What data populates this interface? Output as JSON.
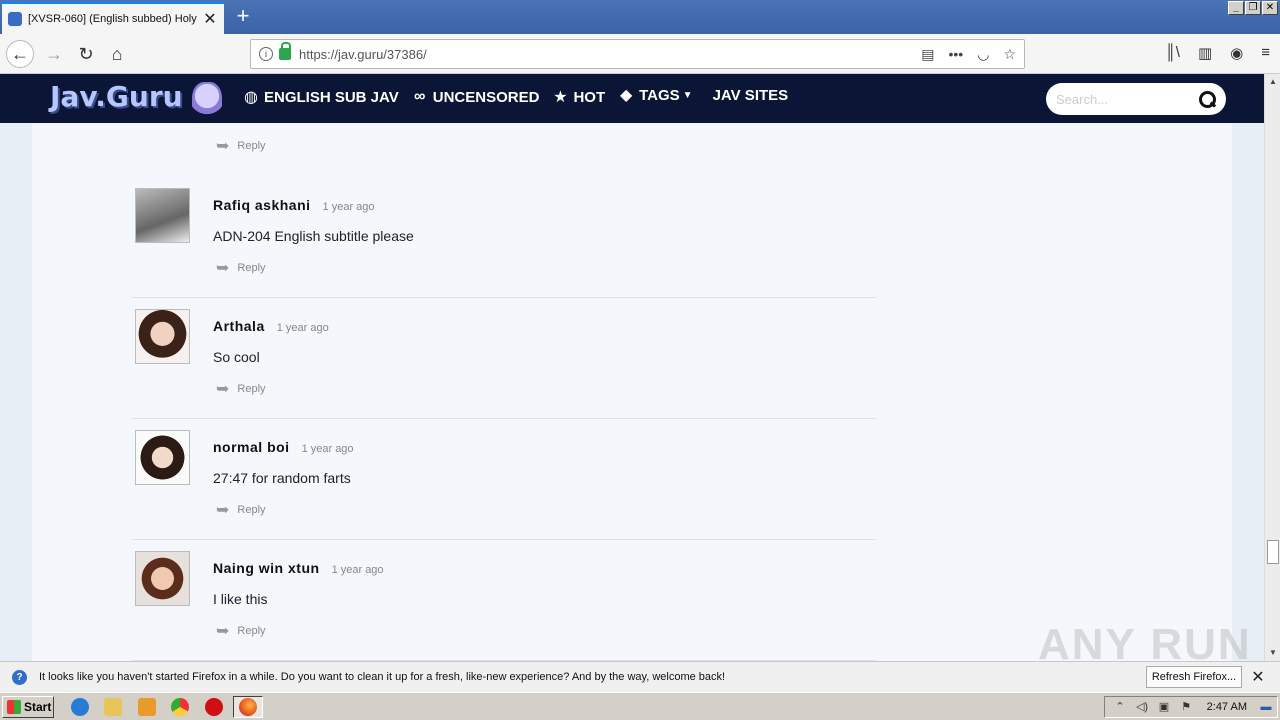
{
  "browser": {
    "tab_title": "[XVSR-060] (English subbed) Holy",
    "url": "https://jav.guru/37386/",
    "new_tab_symbol": "+"
  },
  "site": {
    "logo": "Jav.Guru",
    "menu": [
      {
        "label": "ENGLISH SUB JAV",
        "icon": "globe-icon"
      },
      {
        "label": "UNCENSORED",
        "icon": "glasses-icon"
      },
      {
        "label": "HOT",
        "icon": "star-icon"
      },
      {
        "label": "TAGS",
        "icon": "tag-icon"
      },
      {
        "label": "JAV SITES",
        "icon": ""
      }
    ],
    "search_placeholder": "Search..."
  },
  "reply_label": "Reply",
  "comments": [
    {
      "author": "Rafiq askhani",
      "time": "1 year ago",
      "text": "ADN-204 English subtitle please"
    },
    {
      "author": "Arthala",
      "time": "1 year ago",
      "text": "So cool"
    },
    {
      "author": "normal boi",
      "time": "1 year ago",
      "text": "27:47 for random farts"
    },
    {
      "author": "Naing win xtun",
      "time": "1 year ago",
      "text": "I like this"
    }
  ],
  "notification": {
    "text": "It looks like you haven't started Firefox in a while. Do you want to clean it up for a fresh, like-new experience? And by the way, welcome back!",
    "button": "Refresh Firefox..."
  },
  "taskbar": {
    "start": "Start",
    "clock": "2:47 AM"
  },
  "watermark": "ANY RUN",
  "colors": {
    "header_bg": "#0b1535",
    "page_bg": "#f4f7fb",
    "secure_green": "#2da44e"
  }
}
